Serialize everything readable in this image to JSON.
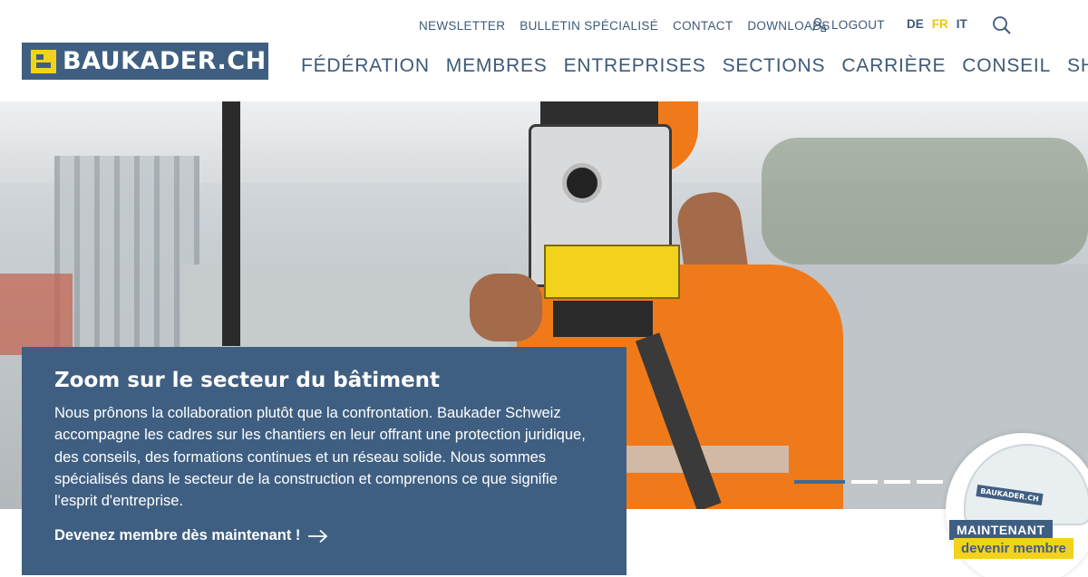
{
  "logo": {
    "text": "BAUKADER.CH"
  },
  "topnav": [
    {
      "label": "NEWSLETTER"
    },
    {
      "label": "BULLETIN SPÉCIALISÉ"
    },
    {
      "label": "CONTACT"
    },
    {
      "label": "DOWNLOADS"
    }
  ],
  "logout": {
    "label": "LOGOUT",
    "icon": "user-icon"
  },
  "languages": {
    "de": "DE",
    "fr": "FR",
    "it": "IT",
    "active": "FR"
  },
  "search": {
    "icon": "search-icon"
  },
  "mainnav": [
    {
      "label": "FÉDÉRATION"
    },
    {
      "label": "MEMBRES"
    },
    {
      "label": "ENTREPRISES"
    },
    {
      "label": "SECTIONS"
    },
    {
      "label": "CARRIÈRE"
    },
    {
      "label": "CONSEIL"
    },
    {
      "label": "SHOP"
    }
  ],
  "hero": {
    "slides": 4,
    "active_slide": 1
  },
  "promo": {
    "title": "Zoom sur le secteur du bâtiment",
    "body": "Nous prônons la collaboration plutôt que la confrontation. Baukader Schweiz accompagne les cadres sur les chantiers en leur offrant une protection juridique, des conseils, des formations continues et un réseau solide. Nous sommes spécialisés dans le secteur de la construction et comprenons ce que signifie l'esprit d'entreprise.",
    "cta": "Devenez membre dès maintenant !"
  },
  "badge": {
    "helmet_label": "BAUKADER.CH",
    "line1": "MAINTENANT",
    "line2": "devenir membre"
  },
  "colors": {
    "brand_blue": "#3f5f82",
    "brand_yellow": "#f3d21a",
    "active_lang": "#f0c800"
  }
}
